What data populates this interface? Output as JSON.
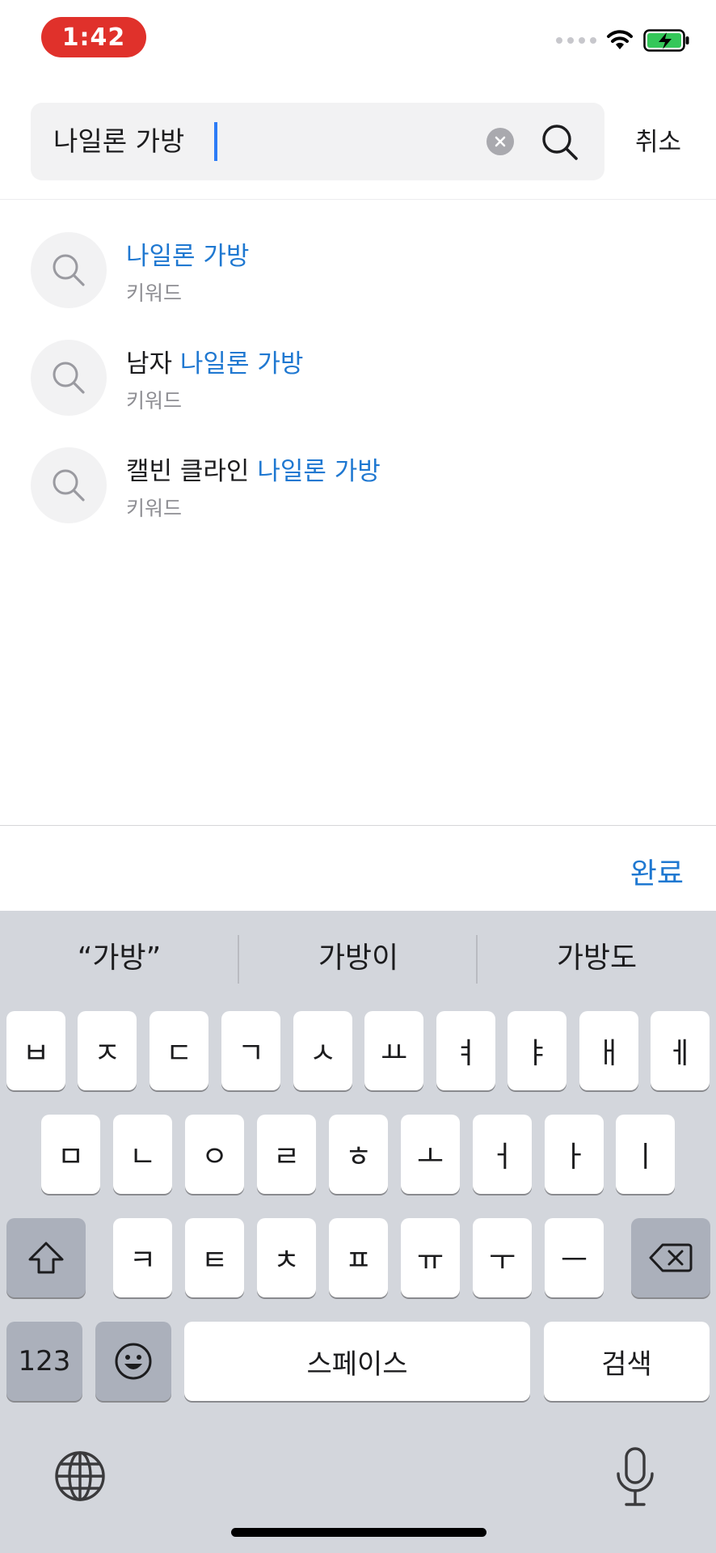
{
  "status_bar": {
    "time": "1:42",
    "battery_color": "#34c759",
    "time_pill_color": "#e0312b"
  },
  "search": {
    "query": "나일론 가방",
    "cancel_label": "취소",
    "clear_icon": "clear-icon",
    "search_icon": "search-icon"
  },
  "suggestions": [
    {
      "prefix": "",
      "match": "나일론 가방",
      "type": "키워드"
    },
    {
      "prefix": "남자 ",
      "match": "나일론 가방",
      "type": "키워드"
    },
    {
      "prefix": "캘빈 클라인 ",
      "match": "나일론 가방",
      "type": "키워드"
    }
  ],
  "accessory": {
    "done_label": "완료",
    "accent_color": "#1f78d1"
  },
  "keyboard": {
    "predictions": [
      "“가방”",
      "가방이",
      "가방도"
    ],
    "row1": [
      "ㅂ",
      "ㅈ",
      "ㄷ",
      "ㄱ",
      "ㅅ",
      "ㅛ",
      "ㅕ",
      "ㅑ",
      "ㅐ",
      "ㅔ"
    ],
    "row2": [
      "ㅁ",
      "ㄴ",
      "ㅇ",
      "ㄹ",
      "ㅎ",
      "ㅗ",
      "ㅓ",
      "ㅏ",
      "ㅣ"
    ],
    "row3": [
      "ㅋ",
      "ㅌ",
      "ㅊ",
      "ㅍ",
      "ㅠ",
      "ㅜ",
      "ㅡ"
    ],
    "numbers_label": "123",
    "space_label": "스페이스",
    "search_label": "검색",
    "shift_icon": "shift-icon",
    "delete_icon": "delete-icon",
    "emoji_icon": "emoji-icon",
    "globe_icon": "globe-icon",
    "mic_icon": "microphone-icon"
  }
}
